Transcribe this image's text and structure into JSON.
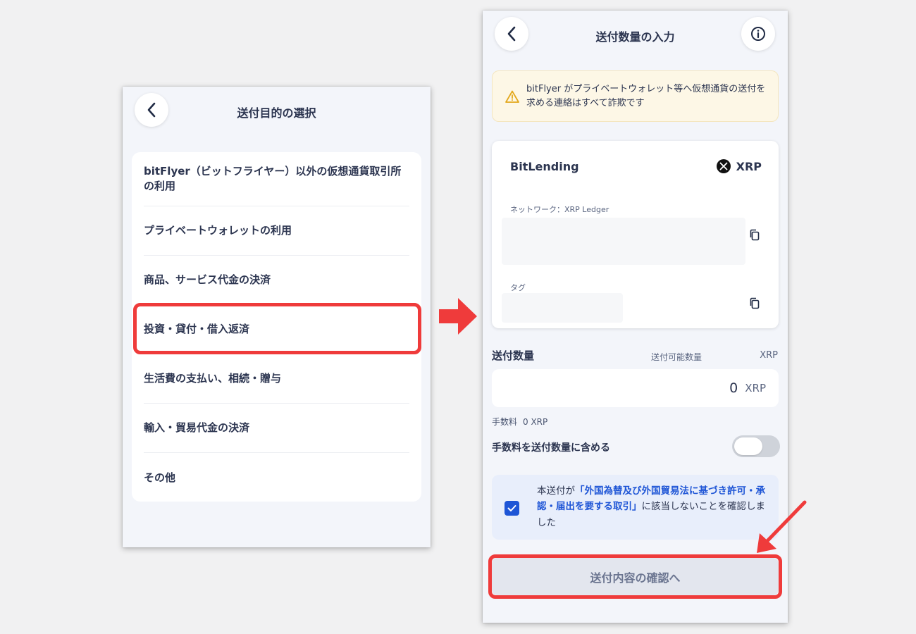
{
  "left_screen": {
    "title": "送付目的の選択",
    "purposes": [
      "bitFlyer（ビットフライヤー）以外の仮想通貨取引所の利用",
      "プライベートウォレットの利用",
      "商品、サービス代金の決済",
      "投資・貸付・借入返済",
      "生活費の支払い、相続・贈与",
      "輸入・貿易代金の決済",
      "その他"
    ]
  },
  "right_screen": {
    "title": "送付数量の入力",
    "warning": "bitFlyer がプライベートウォレット等へ仮想通貨の送付を求める連絡はすべて詐欺です",
    "address_card": {
      "exchange": "BitLending",
      "currency": "XRP",
      "network_label": "ネットワーク：XRP Ledger",
      "tag_label": "タグ"
    },
    "amount": {
      "label": "送付数量",
      "available_label": "送付可能数量",
      "available_unit": "XRP",
      "value": "0",
      "unit": "XRP"
    },
    "fee": {
      "label": "手数料",
      "value": "0 XRP"
    },
    "fee_include_label": "手数料を送付数量に含める",
    "fee_include_on": false,
    "confirmation": {
      "checked": true,
      "prefix": "本送付が",
      "link": "「外国為替及び外国貿易法に基づき許可・承認・届出を要する取引」",
      "suffix": "に該当しないことを確認しました"
    },
    "submit_label": "送付内容の確認へ"
  },
  "colors": {
    "highlight": "#ef3b3b",
    "accent_blue": "#1e55d6",
    "warning_bg": "#fdf7e6"
  }
}
